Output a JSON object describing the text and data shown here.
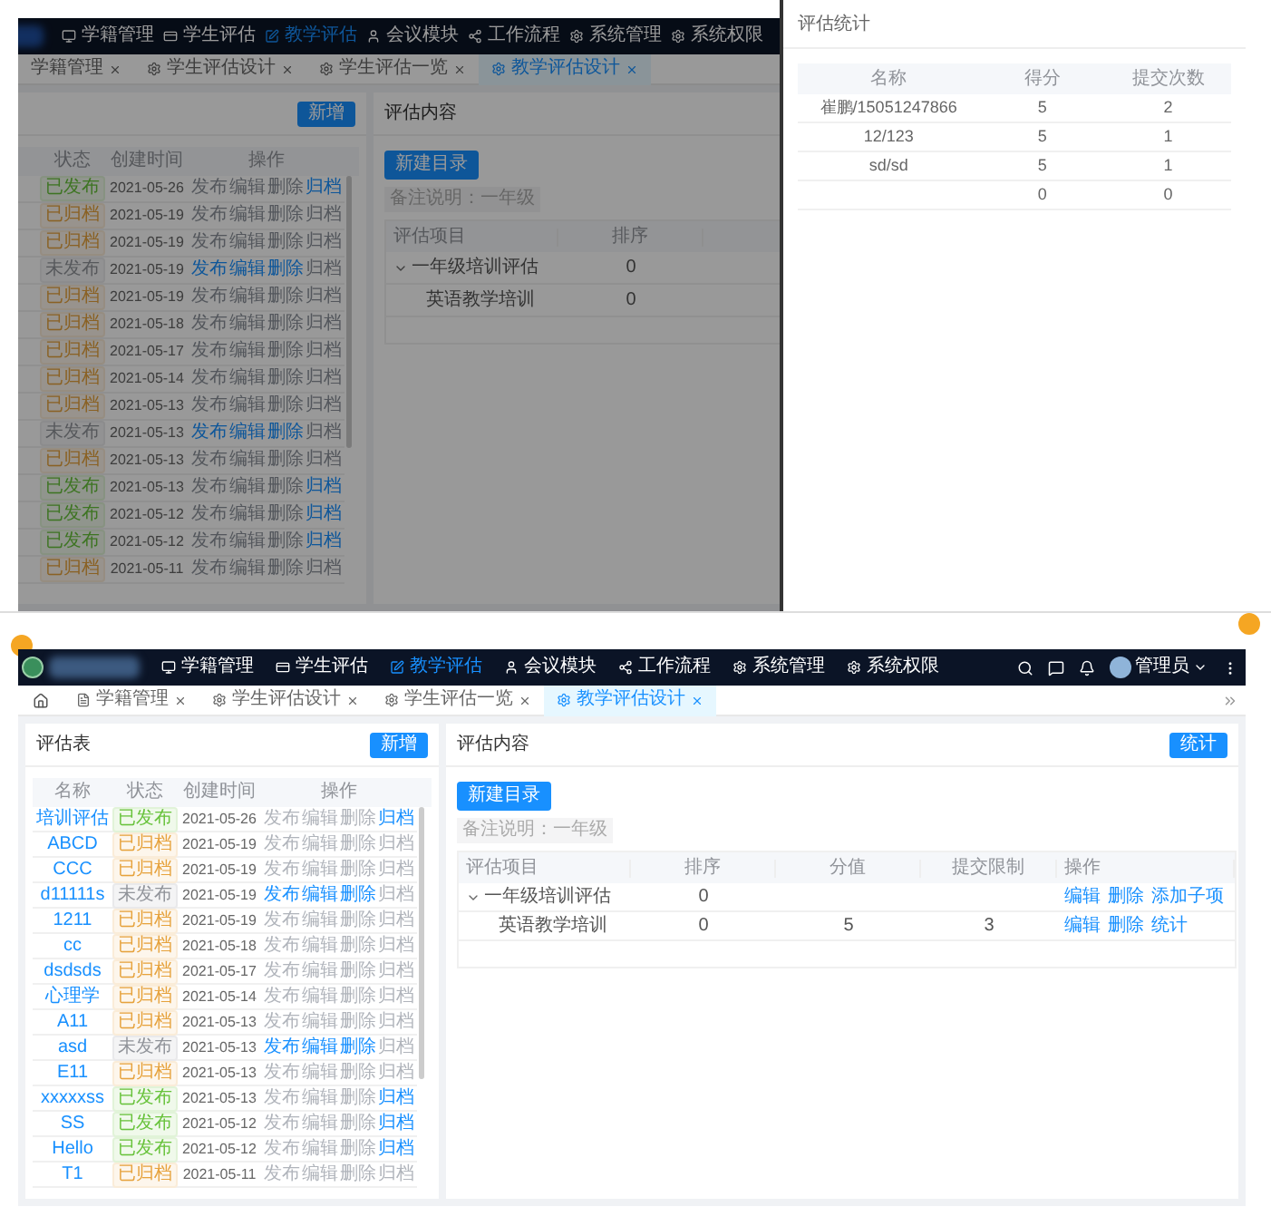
{
  "background_page": {
    "nav": {
      "items": [
        {
          "label": "学籍管理",
          "selected": false
        },
        {
          "label": "学生评估",
          "selected": false
        },
        {
          "label": "教学评估",
          "selected": true
        },
        {
          "label": "会议模块",
          "selected": false
        },
        {
          "label": "工作流程",
          "selected": false
        },
        {
          "label": "系统管理",
          "selected": false
        },
        {
          "label": "系统权限",
          "selected": false
        }
      ]
    },
    "tabs": [
      {
        "label": "学籍管理",
        "selected": false
      },
      {
        "label": "学生评估设计",
        "selected": false
      },
      {
        "label": "学生评估一览",
        "selected": false
      },
      {
        "label": "教学评估设计",
        "selected": true
      }
    ],
    "list_panel": {
      "add_button": "新增",
      "columns": [
        "状态",
        "创建时间",
        "操作"
      ],
      "rows": [
        {
          "status": {
            "label": "已发布",
            "kind": "published"
          },
          "date": "2021-05-26",
          "actions": [
            {
              "label": "发布",
              "disabled": true
            },
            {
              "label": "编辑",
              "disabled": true
            },
            {
              "label": "删除",
              "disabled": true
            },
            {
              "label": "归档",
              "disabled": false
            }
          ]
        },
        {
          "status": {
            "label": "已归档",
            "kind": "archived"
          },
          "date": "2021-05-19",
          "actions": [
            {
              "label": "发布",
              "disabled": true
            },
            {
              "label": "编辑",
              "disabled": true
            },
            {
              "label": "删除",
              "disabled": true
            },
            {
              "label": "归档",
              "disabled": true
            }
          ]
        },
        {
          "status": {
            "label": "已归档",
            "kind": "archived"
          },
          "date": "2021-05-19",
          "actions": [
            {
              "label": "发布",
              "disabled": true
            },
            {
              "label": "编辑",
              "disabled": true
            },
            {
              "label": "删除",
              "disabled": true
            },
            {
              "label": "归档",
              "disabled": true
            }
          ]
        },
        {
          "status": {
            "label": "未发布",
            "kind": "unpublished"
          },
          "date": "2021-05-19",
          "actions": [
            {
              "label": "发布",
              "disabled": false
            },
            {
              "label": "编辑",
              "disabled": false
            },
            {
              "label": "删除",
              "disabled": false
            },
            {
              "label": "归档",
              "disabled": true
            }
          ]
        },
        {
          "status": {
            "label": "已归档",
            "kind": "archived"
          },
          "date": "2021-05-19",
          "actions": [
            {
              "label": "发布",
              "disabled": true
            },
            {
              "label": "编辑",
              "disabled": true
            },
            {
              "label": "删除",
              "disabled": true
            },
            {
              "label": "归档",
              "disabled": true
            }
          ]
        },
        {
          "status": {
            "label": "已归档",
            "kind": "archived"
          },
          "date": "2021-05-18",
          "actions": [
            {
              "label": "发布",
              "disabled": true
            },
            {
              "label": "编辑",
              "disabled": true
            },
            {
              "label": "删除",
              "disabled": true
            },
            {
              "label": "归档",
              "disabled": true
            }
          ]
        },
        {
          "status": {
            "label": "已归档",
            "kind": "archived"
          },
          "date": "2021-05-17",
          "actions": [
            {
              "label": "发布",
              "disabled": true
            },
            {
              "label": "编辑",
              "disabled": true
            },
            {
              "label": "删除",
              "disabled": true
            },
            {
              "label": "归档",
              "disabled": true
            }
          ]
        },
        {
          "status": {
            "label": "已归档",
            "kind": "archived"
          },
          "date": "2021-05-14",
          "actions": [
            {
              "label": "发布",
              "disabled": true
            },
            {
              "label": "编辑",
              "disabled": true
            },
            {
              "label": "删除",
              "disabled": true
            },
            {
              "label": "归档",
              "disabled": true
            }
          ]
        },
        {
          "status": {
            "label": "已归档",
            "kind": "archived"
          },
          "date": "2021-05-13",
          "actions": [
            {
              "label": "发布",
              "disabled": true
            },
            {
              "label": "编辑",
              "disabled": true
            },
            {
              "label": "删除",
              "disabled": true
            },
            {
              "label": "归档",
              "disabled": true
            }
          ]
        },
        {
          "status": {
            "label": "未发布",
            "kind": "unpublished"
          },
          "date": "2021-05-13",
          "actions": [
            {
              "label": "发布",
              "disabled": false
            },
            {
              "label": "编辑",
              "disabled": false
            },
            {
              "label": "删除",
              "disabled": false
            },
            {
              "label": "归档",
              "disabled": true
            }
          ]
        },
        {
          "status": {
            "label": "已归档",
            "kind": "archived"
          },
          "date": "2021-05-13",
          "actions": [
            {
              "label": "发布",
              "disabled": true
            },
            {
              "label": "编辑",
              "disabled": true
            },
            {
              "label": "删除",
              "disabled": true
            },
            {
              "label": "归档",
              "disabled": true
            }
          ]
        },
        {
          "status": {
            "label": "已发布",
            "kind": "published"
          },
          "date": "2021-05-13",
          "actions": [
            {
              "label": "发布",
              "disabled": true
            },
            {
              "label": "编辑",
              "disabled": true
            },
            {
              "label": "删除",
              "disabled": true
            },
            {
              "label": "归档",
              "disabled": false
            }
          ]
        },
        {
          "status": {
            "label": "已发布",
            "kind": "published"
          },
          "date": "2021-05-12",
          "actions": [
            {
              "label": "发布",
              "disabled": true
            },
            {
              "label": "编辑",
              "disabled": true
            },
            {
              "label": "删除",
              "disabled": true
            },
            {
              "label": "归档",
              "disabled": false
            }
          ]
        },
        {
          "status": {
            "label": "已发布",
            "kind": "published"
          },
          "date": "2021-05-12",
          "actions": [
            {
              "label": "发布",
              "disabled": true
            },
            {
              "label": "编辑",
              "disabled": true
            },
            {
              "label": "删除",
              "disabled": true
            },
            {
              "label": "归档",
              "disabled": false
            }
          ]
        },
        {
          "status": {
            "label": "已归档",
            "kind": "archived"
          },
          "date": "2021-05-11",
          "actions": [
            {
              "label": "发布",
              "disabled": true
            },
            {
              "label": "编辑",
              "disabled": true
            },
            {
              "label": "删除",
              "disabled": true
            },
            {
              "label": "归档",
              "disabled": true
            }
          ]
        }
      ]
    },
    "content_panel": {
      "title": "评估内容",
      "new_button": "新建目录",
      "note": "备注说明：一年级",
      "columns": [
        "评估项目",
        "排序"
      ],
      "rows": [
        {
          "item": "一年级培训评估",
          "order": "0",
          "expanded": true,
          "children": [
            {
              "item": "英语教学培训",
              "order": "0"
            }
          ]
        }
      ]
    }
  },
  "stats_drawer": {
    "title": "评估统计",
    "columns": [
      "名称",
      "得分",
      "提交次数"
    ],
    "rows": [
      {
        "name": "崔鹏/15051247866",
        "score": "5",
        "count": "2"
      },
      {
        "name": "12/123",
        "score": "5",
        "count": "1"
      },
      {
        "name": "sd/sd",
        "score": "5",
        "count": "1"
      },
      {
        "score": "0",
        "count": "0"
      }
    ]
  },
  "page": {
    "nav": {
      "items": [
        {
          "label": "学籍管理",
          "selected": false
        },
        {
          "label": "学生评估",
          "selected": false
        },
        {
          "label": "教学评估",
          "selected": true
        },
        {
          "label": "会议模块",
          "selected": false
        },
        {
          "label": "工作流程",
          "selected": false
        },
        {
          "label": "系统管理",
          "selected": false
        },
        {
          "label": "系统权限",
          "selected": false
        }
      ],
      "user": "管理员"
    },
    "tabs": [
      {
        "label": "学籍管理",
        "selected": false
      },
      {
        "label": "学生评估设计",
        "selected": false
      },
      {
        "label": "学生评估一览",
        "selected": false
      },
      {
        "label": "教学评估设计",
        "selected": true
      }
    ],
    "list_panel": {
      "title": "评估表",
      "add_button": "新增",
      "columns": [
        "名称",
        "状态",
        "创建时间",
        "操作"
      ],
      "rows": [
        {
          "name": "培训评估",
          "status": {
            "label": "已发布",
            "kind": "published"
          },
          "date": "2021-05-26",
          "actions": [
            {
              "label": "发布",
              "disabled": true
            },
            {
              "label": "编辑",
              "disabled": true
            },
            {
              "label": "删除",
              "disabled": true
            },
            {
              "label": "归档",
              "disabled": false
            }
          ]
        },
        {
          "name": "ABCD",
          "status": {
            "label": "已归档",
            "kind": "archived"
          },
          "date": "2021-05-19",
          "actions": [
            {
              "label": "发布",
              "disabled": true
            },
            {
              "label": "编辑",
              "disabled": true
            },
            {
              "label": "删除",
              "disabled": true
            },
            {
              "label": "归档",
              "disabled": true
            }
          ]
        },
        {
          "name": "CCC",
          "status": {
            "label": "已归档",
            "kind": "archived"
          },
          "date": "2021-05-19",
          "actions": [
            {
              "label": "发布",
              "disabled": true
            },
            {
              "label": "编辑",
              "disabled": true
            },
            {
              "label": "删除",
              "disabled": true
            },
            {
              "label": "归档",
              "disabled": true
            }
          ]
        },
        {
          "name": "d11111s",
          "status": {
            "label": "未发布",
            "kind": "unpublished"
          },
          "date": "2021-05-19",
          "actions": [
            {
              "label": "发布",
              "disabled": false
            },
            {
              "label": "编辑",
              "disabled": false
            },
            {
              "label": "删除",
              "disabled": false
            },
            {
              "label": "归档",
              "disabled": true
            }
          ]
        },
        {
          "name": "1211",
          "status": {
            "label": "已归档",
            "kind": "archived"
          },
          "date": "2021-05-19",
          "actions": [
            {
              "label": "发布",
              "disabled": true
            },
            {
              "label": "编辑",
              "disabled": true
            },
            {
              "label": "删除",
              "disabled": true
            },
            {
              "label": "归档",
              "disabled": true
            }
          ]
        },
        {
          "name": "cc",
          "status": {
            "label": "已归档",
            "kind": "archived"
          },
          "date": "2021-05-18",
          "actions": [
            {
              "label": "发布",
              "disabled": true
            },
            {
              "label": "编辑",
              "disabled": true
            },
            {
              "label": "删除",
              "disabled": true
            },
            {
              "label": "归档",
              "disabled": true
            }
          ]
        },
        {
          "name": "dsdsds",
          "status": {
            "label": "已归档",
            "kind": "archived"
          },
          "date": "2021-05-17",
          "actions": [
            {
              "label": "发布",
              "disabled": true
            },
            {
              "label": "编辑",
              "disabled": true
            },
            {
              "label": "删除",
              "disabled": true
            },
            {
              "label": "归档",
              "disabled": true
            }
          ]
        },
        {
          "name": "心理学",
          "status": {
            "label": "已归档",
            "kind": "archived"
          },
          "date": "2021-05-14",
          "actions": [
            {
              "label": "发布",
              "disabled": true
            },
            {
              "label": "编辑",
              "disabled": true
            },
            {
              "label": "删除",
              "disabled": true
            },
            {
              "label": "归档",
              "disabled": true
            }
          ]
        },
        {
          "name": "A11",
          "status": {
            "label": "已归档",
            "kind": "archived"
          },
          "date": "2021-05-13",
          "actions": [
            {
              "label": "发布",
              "disabled": true
            },
            {
              "label": "编辑",
              "disabled": true
            },
            {
              "label": "删除",
              "disabled": true
            },
            {
              "label": "归档",
              "disabled": true
            }
          ]
        },
        {
          "name": "asd",
          "status": {
            "label": "未发布",
            "kind": "unpublished"
          },
          "date": "2021-05-13",
          "actions": [
            {
              "label": "发布",
              "disabled": false
            },
            {
              "label": "编辑",
              "disabled": false
            },
            {
              "label": "删除",
              "disabled": false
            },
            {
              "label": "归档",
              "disabled": true
            }
          ]
        },
        {
          "name": "E11",
          "status": {
            "label": "已归档",
            "kind": "archived"
          },
          "date": "2021-05-13",
          "actions": [
            {
              "label": "发布",
              "disabled": true
            },
            {
              "label": "编辑",
              "disabled": true
            },
            {
              "label": "删除",
              "disabled": true
            },
            {
              "label": "归档",
              "disabled": true
            }
          ]
        },
        {
          "name": "xxxxxss",
          "status": {
            "label": "已发布",
            "kind": "published"
          },
          "date": "2021-05-13",
          "actions": [
            {
              "label": "发布",
              "disabled": true
            },
            {
              "label": "编辑",
              "disabled": true
            },
            {
              "label": "删除",
              "disabled": true
            },
            {
              "label": "归档",
              "disabled": false
            }
          ]
        },
        {
          "name": "SS",
          "status": {
            "label": "已发布",
            "kind": "published"
          },
          "date": "2021-05-12",
          "actions": [
            {
              "label": "发布",
              "disabled": true
            },
            {
              "label": "编辑",
              "disabled": true
            },
            {
              "label": "删除",
              "disabled": true
            },
            {
              "label": "归档",
              "disabled": false
            }
          ]
        },
        {
          "name": "Hello",
          "status": {
            "label": "已发布",
            "kind": "published"
          },
          "date": "2021-05-12",
          "actions": [
            {
              "label": "发布",
              "disabled": true
            },
            {
              "label": "编辑",
              "disabled": true
            },
            {
              "label": "删除",
              "disabled": true
            },
            {
              "label": "归档",
              "disabled": false
            }
          ]
        },
        {
          "name": "T1",
          "status": {
            "label": "已归档",
            "kind": "archived"
          },
          "date": "2021-05-11",
          "actions": [
            {
              "label": "发布",
              "disabled": true
            },
            {
              "label": "编辑",
              "disabled": true
            },
            {
              "label": "删除",
              "disabled": true
            },
            {
              "label": "归档",
              "disabled": true
            }
          ]
        }
      ]
    },
    "content_panel": {
      "title": "评估内容",
      "stats_button": "统计",
      "new_button": "新建目录",
      "note": "备注说明：一年级",
      "columns": [
        "评估项目",
        "排序",
        "分值",
        "提交限制",
        "操作"
      ],
      "rows": [
        {
          "item": "一年级培训评估",
          "order": "0",
          "expanded": true,
          "actions": [
            {
              "label": "编辑"
            },
            {
              "label": "删除"
            },
            {
              "label": "添加子项"
            }
          ],
          "children": [
            {
              "item": "英语教学培训",
              "order": "0",
              "score": "5",
              "limit": "3",
              "actions": [
                {
                  "label": "编辑"
                },
                {
                  "label": "删除"
                },
                {
                  "label": "统计"
                }
              ]
            }
          ]
        }
      ]
    }
  }
}
